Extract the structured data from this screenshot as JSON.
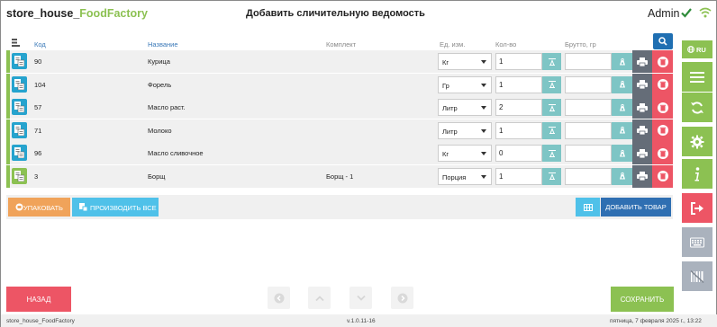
{
  "app": {
    "brand_prefix": "store_house_",
    "brand_accent": "FoodFactory",
    "page_title": "Добавить сличительную ведомость",
    "user": "Admin"
  },
  "table": {
    "columns": {
      "code": "Код",
      "name": "Название",
      "complect": "Комплект",
      "unit": "Ед. изм.",
      "qty": "Кол-во",
      "brutto": "Брутто, гр"
    },
    "rows": [
      {
        "code": "90",
        "name": "Курица",
        "complect": "",
        "unit": "Кг",
        "qty": "1",
        "icon_color": "#26a3ce"
      },
      {
        "code": "104",
        "name": "Форель",
        "complect": "",
        "unit": "Гр",
        "qty": "1",
        "icon_color": "#26a3ce"
      },
      {
        "code": "57",
        "name": "Масло раст.",
        "complect": "",
        "unit": "Литр",
        "qty": "2",
        "icon_color": "#26a3ce"
      },
      {
        "code": "71",
        "name": "Молоко",
        "complect": "",
        "unit": "Литр",
        "qty": "1",
        "icon_color": "#26a3ce"
      },
      {
        "code": "96",
        "name": "Масло сливочное",
        "complect": "",
        "unit": "Кг",
        "qty": "0",
        "icon_color": "#26a3ce"
      },
      {
        "code": "3",
        "name": "Борщ",
        "complect": "Борщ - 1",
        "unit": "Порция",
        "qty": "1",
        "icon_color": "#8cc152"
      }
    ]
  },
  "actions": {
    "pack_label": "УПАКОВАТЬ",
    "produce_all_label": "ПРОИЗВОДИТЬ ВСЕ",
    "add_product_label": "ДОБАВИТЬ ТОВАР"
  },
  "sidebar": {
    "lang_label": "RU",
    "buttons": [
      {
        "name": "menu",
        "color": "#8cc152"
      },
      {
        "name": "sync",
        "color": "#8cc152"
      },
      {
        "name": "settings",
        "color": "#8cc152"
      },
      {
        "name": "info",
        "color": "#8cc152"
      },
      {
        "name": "logout",
        "color": "#ed5565"
      },
      {
        "name": "keyboard",
        "color": "#aab2bd"
      },
      {
        "name": "barcode",
        "color": "#aab2bd"
      }
    ]
  },
  "footer": {
    "back_label": "НАЗАД",
    "save_label": "СОХРАНИТЬ"
  },
  "status": {
    "app_name": "store_house_FoodFactory",
    "version": "v.1.0.11-16",
    "datetime": "пятница, 7 февраля 2025 г., 13:22"
  },
  "colors": {
    "green": "#8cc152",
    "blue": "#26a3ce",
    "dark_blue": "#2f6fb2",
    "red": "#ed5565",
    "orange": "#f0a35a",
    "teal": "#7ec5c5",
    "gray": "#656d78"
  }
}
